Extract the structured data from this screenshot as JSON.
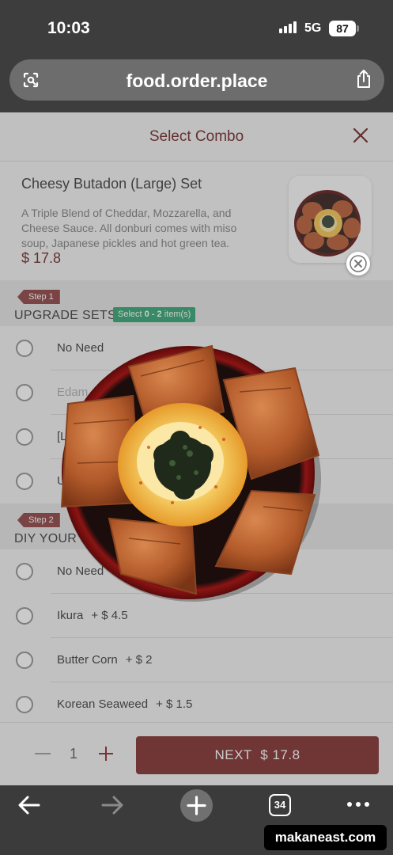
{
  "status_bar": {
    "time": "10:03",
    "network": "5G",
    "battery": "87"
  },
  "browser": {
    "url": "food.order.place",
    "site_icon": "site-settings-icon",
    "share_icon": "share-icon",
    "toolbar": {
      "back_icon": "back-arrow-icon",
      "forward_icon": "forward-arrow-icon",
      "new_tab_icon": "plus-icon",
      "tab_count": "34",
      "menu_icon": "more-dots-icon"
    }
  },
  "modal": {
    "title": "Select Combo",
    "close_icon": "close-icon",
    "product": {
      "name": "Cheesy Butadon (Large) Set",
      "description": "A Triple Blend of Cheddar, Mozzarella, and Cheese Sauce. All donburi comes with miso soup, Japanese pickles and hot green tea.",
      "price": "$ 17.8"
    },
    "steps": [
      {
        "tag": "Step 1",
        "title": "UPGRADE SETS",
        "badge_prefix": "Select ",
        "badge_range": "0 - 2",
        "badge_suffix": " item(s)",
        "options": [
          {
            "label": "No Need",
            "price": "",
            "muted": false
          },
          {
            "label": "Edam",
            "price": "",
            "muted": true
          },
          {
            "label": "[L",
            "price": "",
            "muted": false
          },
          {
            "label": "U",
            "price": "",
            "muted": false
          }
        ]
      },
      {
        "tag": "Step 2",
        "title": "DIY YOUR SE",
        "options": [
          {
            "label": "No Need",
            "price": "",
            "muted": false
          },
          {
            "label": "Ikura",
            "price": "+ $ 4.5",
            "muted": false
          },
          {
            "label": "Butter Corn",
            "price": "+ $ 2",
            "muted": false
          },
          {
            "label": "Korean Seaweed",
            "price": "+ $ 1.5",
            "muted": false
          }
        ]
      }
    ],
    "footer": {
      "quantity": "1",
      "next_label": "NEXT",
      "next_price": "$ 17.8"
    }
  },
  "watermark": "makaneast.com",
  "colors": {
    "brand": "#7b2424",
    "badge": "#28a06a",
    "status_bar": "#3d3d3d"
  }
}
